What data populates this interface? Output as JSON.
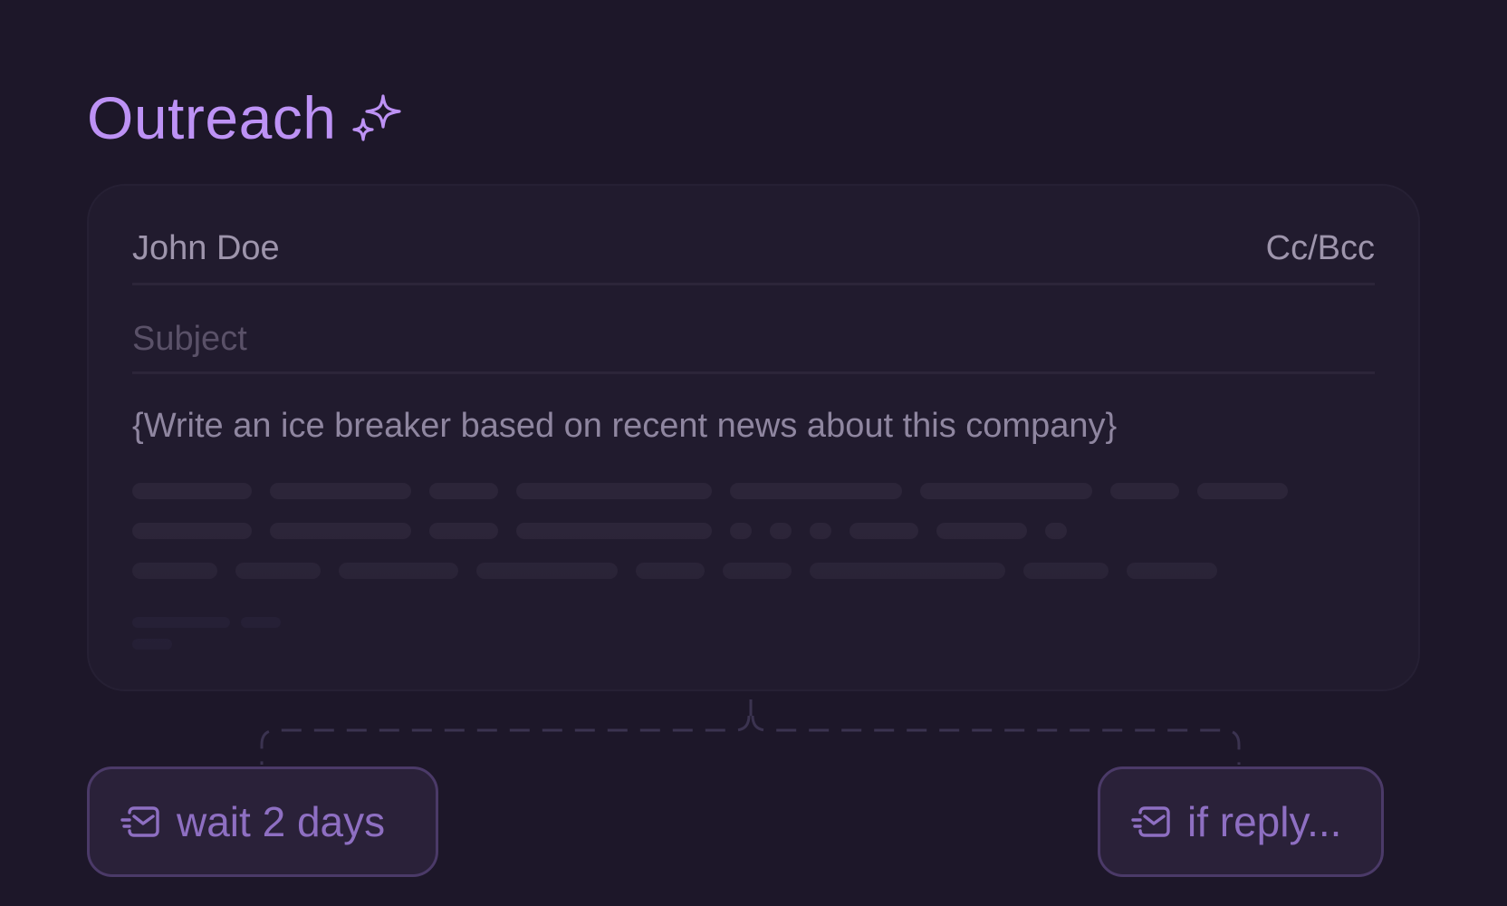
{
  "header": {
    "title": "Outreach",
    "title_icon": "sparkles-icon"
  },
  "email": {
    "to": "John Doe",
    "cc_bcc_label": "Cc/Bcc",
    "subject_placeholder": "Subject",
    "body_prompt": "{Write an ice breaker based on recent news about this company}"
  },
  "branches": {
    "wait": {
      "icon": "mail-icon",
      "label": "wait 2 days"
    },
    "reply": {
      "icon": "mail-icon",
      "label": "if reply..."
    }
  },
  "colors": {
    "background": "#1d1729",
    "accent": "#bd92f5",
    "chip_text": "#8e6fc2",
    "card": "#211b2e"
  }
}
